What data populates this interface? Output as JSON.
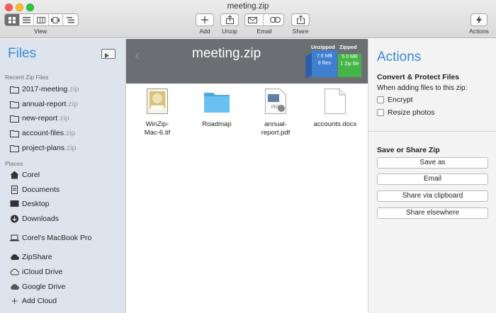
{
  "window": {
    "title": "meeting.zip"
  },
  "toolbar": {
    "view_label": "View",
    "view_buttons": [
      "grid-view-icon",
      "list-view-icon",
      "columns-view-icon",
      "coverflow-view-icon",
      "details-view-icon"
    ],
    "add_label": "Add",
    "unzip_label": "Unzip",
    "email_label": "Email",
    "share_label": "Share",
    "actions_label": "Actions"
  },
  "sidebar": {
    "title": "Files",
    "recent_heading": "Recent Zip Files",
    "recent_files": [
      {
        "name": "2017-meeting",
        "ext": ".zip"
      },
      {
        "name": "annual-report",
        "ext": ".zip"
      },
      {
        "name": "new-report",
        "ext": ".zip"
      },
      {
        "name": "account-files",
        "ext": ".zip"
      },
      {
        "name": "project-plans",
        "ext": ".zip"
      }
    ],
    "places_heading": "Places",
    "places": [
      "Corel",
      "Documents",
      "Desktop",
      "Downloads"
    ],
    "device": "Corel's MacBook Pro",
    "cloud": [
      "ZipShare",
      "iCloud Drive",
      "Google Drive",
      "Add Cloud"
    ]
  },
  "main": {
    "banner_title": "meeting.zip",
    "banner_ghost": "←  ​",
    "unzipped": {
      "heading": "Unzipped",
      "size": "7.6 MB",
      "count": "8 files"
    },
    "zipped": {
      "heading": "Zipped",
      "size": "5.0 MB",
      "count": "1 Zip file"
    },
    "files": [
      {
        "line1": "WinZip-",
        "line2": "Mac-6.tif"
      },
      {
        "line1": "Roadmap",
        "line2": ""
      },
      {
        "line1": "annual-",
        "line2": "report.pdf"
      },
      {
        "line1": "accounts.docx",
        "line2": ""
      }
    ]
  },
  "actions": {
    "title": "Actions",
    "convert_heading": "Convert & Protect Files",
    "convert_text": "When adding files to this zip:",
    "encrypt_label": "Encrypt",
    "resize_label": "Resize photos",
    "save_heading": "Save or Share Zip",
    "save_as_label": "Save as",
    "email_label": "Email",
    "clipboard_label": "Share via clipboard",
    "elsewhere_label": "Share elsewhere"
  },
  "colors": {
    "accent": "#3a8ad8",
    "unzipped_box": "#3f7fd0",
    "zipped_box": "#45b548",
    "folder": "#5ab4ea"
  }
}
